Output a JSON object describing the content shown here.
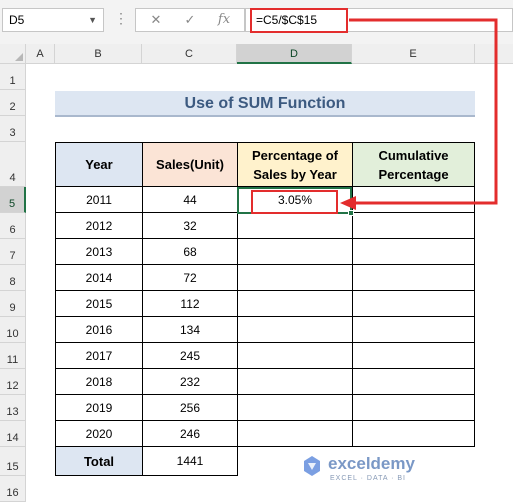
{
  "name_box": "D5",
  "formula_bar": {
    "cancel_icon": "✕",
    "enter_icon": "✓",
    "fx_icon": "fx",
    "formula": "=C5/$C$15"
  },
  "columns": [
    "A",
    "B",
    "C",
    "D",
    "E"
  ],
  "rows": [
    "1",
    "2",
    "3",
    "4",
    "5",
    "6",
    "7",
    "8",
    "9",
    "10",
    "11",
    "12",
    "13",
    "14",
    "15",
    "16"
  ],
  "title": "Use of SUM Function",
  "table": {
    "headers": [
      "Year",
      "Sales(Unit)",
      "Percentage of Sales by Year",
      "Cumulative Percentage"
    ],
    "rows": [
      {
        "year": "2011",
        "sales": "44",
        "pct": "3.05%",
        "cum": ""
      },
      {
        "year": "2012",
        "sales": "32",
        "pct": "",
        "cum": ""
      },
      {
        "year": "2013",
        "sales": "68",
        "pct": "",
        "cum": ""
      },
      {
        "year": "2014",
        "sales": "72",
        "pct": "",
        "cum": ""
      },
      {
        "year": "2015",
        "sales": "112",
        "pct": "",
        "cum": ""
      },
      {
        "year": "2016",
        "sales": "134",
        "pct": "",
        "cum": ""
      },
      {
        "year": "2017",
        "sales": "245",
        "pct": "",
        "cum": ""
      },
      {
        "year": "2018",
        "sales": "232",
        "pct": "",
        "cum": ""
      },
      {
        "year": "2019",
        "sales": "256",
        "pct": "",
        "cum": ""
      },
      {
        "year": "2020",
        "sales": "246",
        "pct": "",
        "cum": ""
      }
    ],
    "total_label": "Total",
    "total_value": "1441"
  },
  "header_colors": {
    "year": "#dde6f2",
    "sales": "#fbe4d6",
    "pct": "#fff2cc",
    "cum": "#e2efda"
  },
  "annotation_color": "#e32d2d",
  "selection_color": "#217346",
  "watermark": {
    "brand": "exceldemy",
    "tagline": "EXCEL · DATA · BI"
  }
}
